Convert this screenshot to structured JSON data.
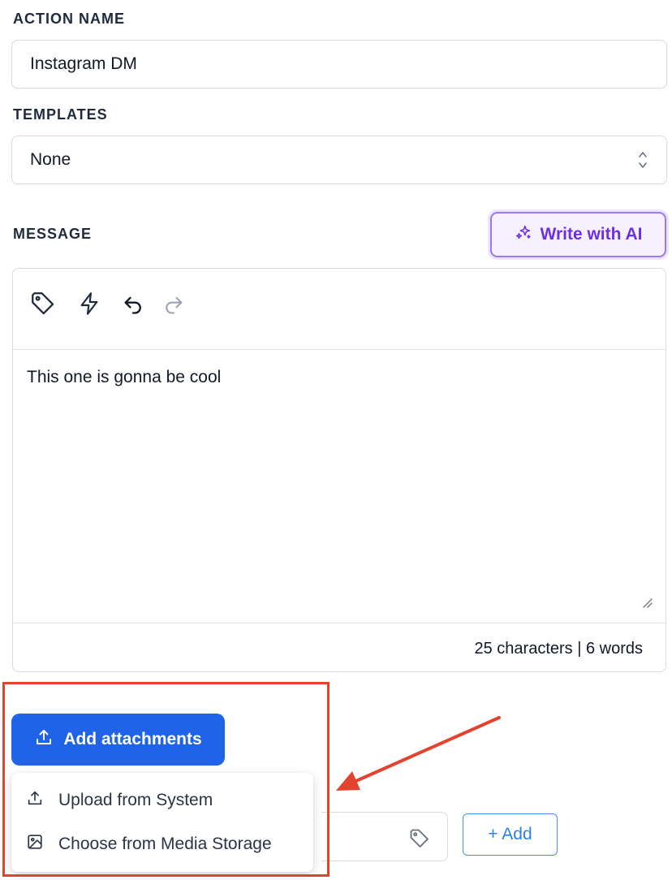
{
  "action_name": {
    "label": "ACTION NAME",
    "value": "Instagram DM"
  },
  "templates": {
    "label": "TEMPLATES",
    "selected": "None"
  },
  "message": {
    "label": "MESSAGE",
    "ai_button_label": "Write with AI",
    "toolbar_icons": [
      "tag-icon",
      "lightning-icon",
      "undo-icon",
      "redo-icon"
    ],
    "body": "This one is gonna be cool",
    "counts": "25 characters | 6 words"
  },
  "attachments": {
    "button_label": "Add attachments",
    "menu": [
      {
        "label": "Upload from System",
        "icon": "upload-icon"
      },
      {
        "label": "Choose from Media Storage",
        "icon": "image-icon"
      }
    ]
  },
  "add_button_label": "+ Add",
  "colors": {
    "primary": "#1f63e8",
    "ai_accent": "#6d2fe3",
    "annotation_red": "#e3432e"
  }
}
